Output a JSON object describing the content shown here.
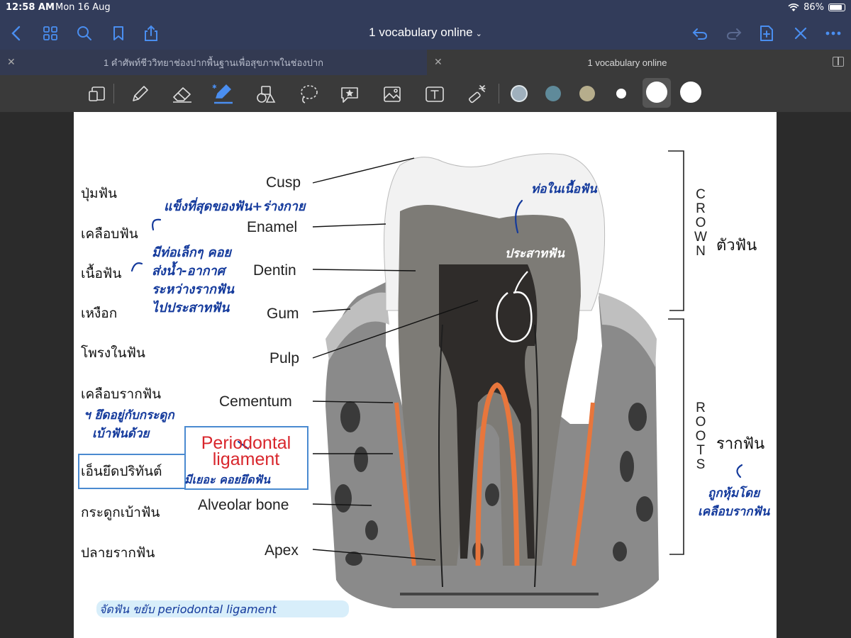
{
  "status_bar": {
    "time": "12:58 AM",
    "date": "Mon 16 Aug",
    "battery": "86%",
    "battery_level": 0.86
  },
  "nav": {
    "title": "1 vocabulary online",
    "icons": [
      "back-icon",
      "grid-icon",
      "search-icon",
      "bookmark-icon",
      "share-icon",
      "undo-icon",
      "redo-icon",
      "add-page-icon",
      "close-icon",
      "more-icon"
    ]
  },
  "tabs": [
    {
      "label": "1 คำศัพท์ชีววิทยาช่องปากพื้นฐานเพื่อสุขภาพในช่องปาก",
      "active": false
    },
    {
      "label": "1 vocabulary online",
      "active": true
    }
  ],
  "toolbar": {
    "tools": [
      "page-layout-icon",
      "pen-icon",
      "eraser-icon",
      "highlighter-icon",
      "shapes-icon",
      "lasso-icon",
      "sticker-icon",
      "image-icon",
      "text-icon",
      "laser-icon"
    ],
    "selected_tool": "highlighter-icon",
    "colors": [
      "#9fb0bd",
      "#5f8a9a",
      "#b6ad8c",
      "#ffffff",
      "#ffffff",
      "#ffffff"
    ],
    "selected_swatch": 4
  },
  "note": {
    "thai_terms": [
      "ปุ่มฟัน",
      "เคลือบฟัน",
      "เนื้อฟัน",
      "เหงือก",
      "โพรงในฟัน",
      "เคลือบรากฟัน",
      "เอ็นยึดปริทันต์",
      "กระดูกเบ้าฟัน",
      "ปลายรากฟัน"
    ],
    "english_labels": [
      "Cusp",
      "Enamel",
      "Dentin",
      "Gum",
      "Pulp",
      "Cementum",
      "Alveolar bone",
      "Apex"
    ],
    "periodontal_line1": "Periodontal",
    "periodontal_line2": "ligament",
    "crown_letters": [
      "C",
      "R",
      "O",
      "W",
      "N"
    ],
    "roots_letters": [
      "R",
      "O",
      "O",
      "T",
      "S"
    ],
    "crown_thai": "ตัวฟัน",
    "roots_thai": "รากฟัน",
    "hand_enamel": "แข็งที่สุดของฟัน+ร่างกาย",
    "hand_dentin_1": "มีท่อเล็กๆ คอย",
    "hand_dentin_2": "ส่งน้ำ-อากาศ",
    "hand_dentin_3": "ระหว่างรากฟัน",
    "hand_dentin_4": "ไปประสาทฟัน",
    "hand_tubule": "ท่อในเนื้อฟัน",
    "hand_nerve": "ประสาทฟัน",
    "hand_cementum_1": "ฯ ยึดอยู่กับกระดูก",
    "hand_cementum_2": "เบ้าฟันด้วย",
    "hand_ligament": "มีเยอะ คอยยึดฟัน",
    "hand_roots_1": "ถูกหุ้มโดย",
    "hand_roots_2": "เคลือบรากฟัน",
    "hand_bottom": "จัดฟัน ขยับ periodontal ligament"
  }
}
